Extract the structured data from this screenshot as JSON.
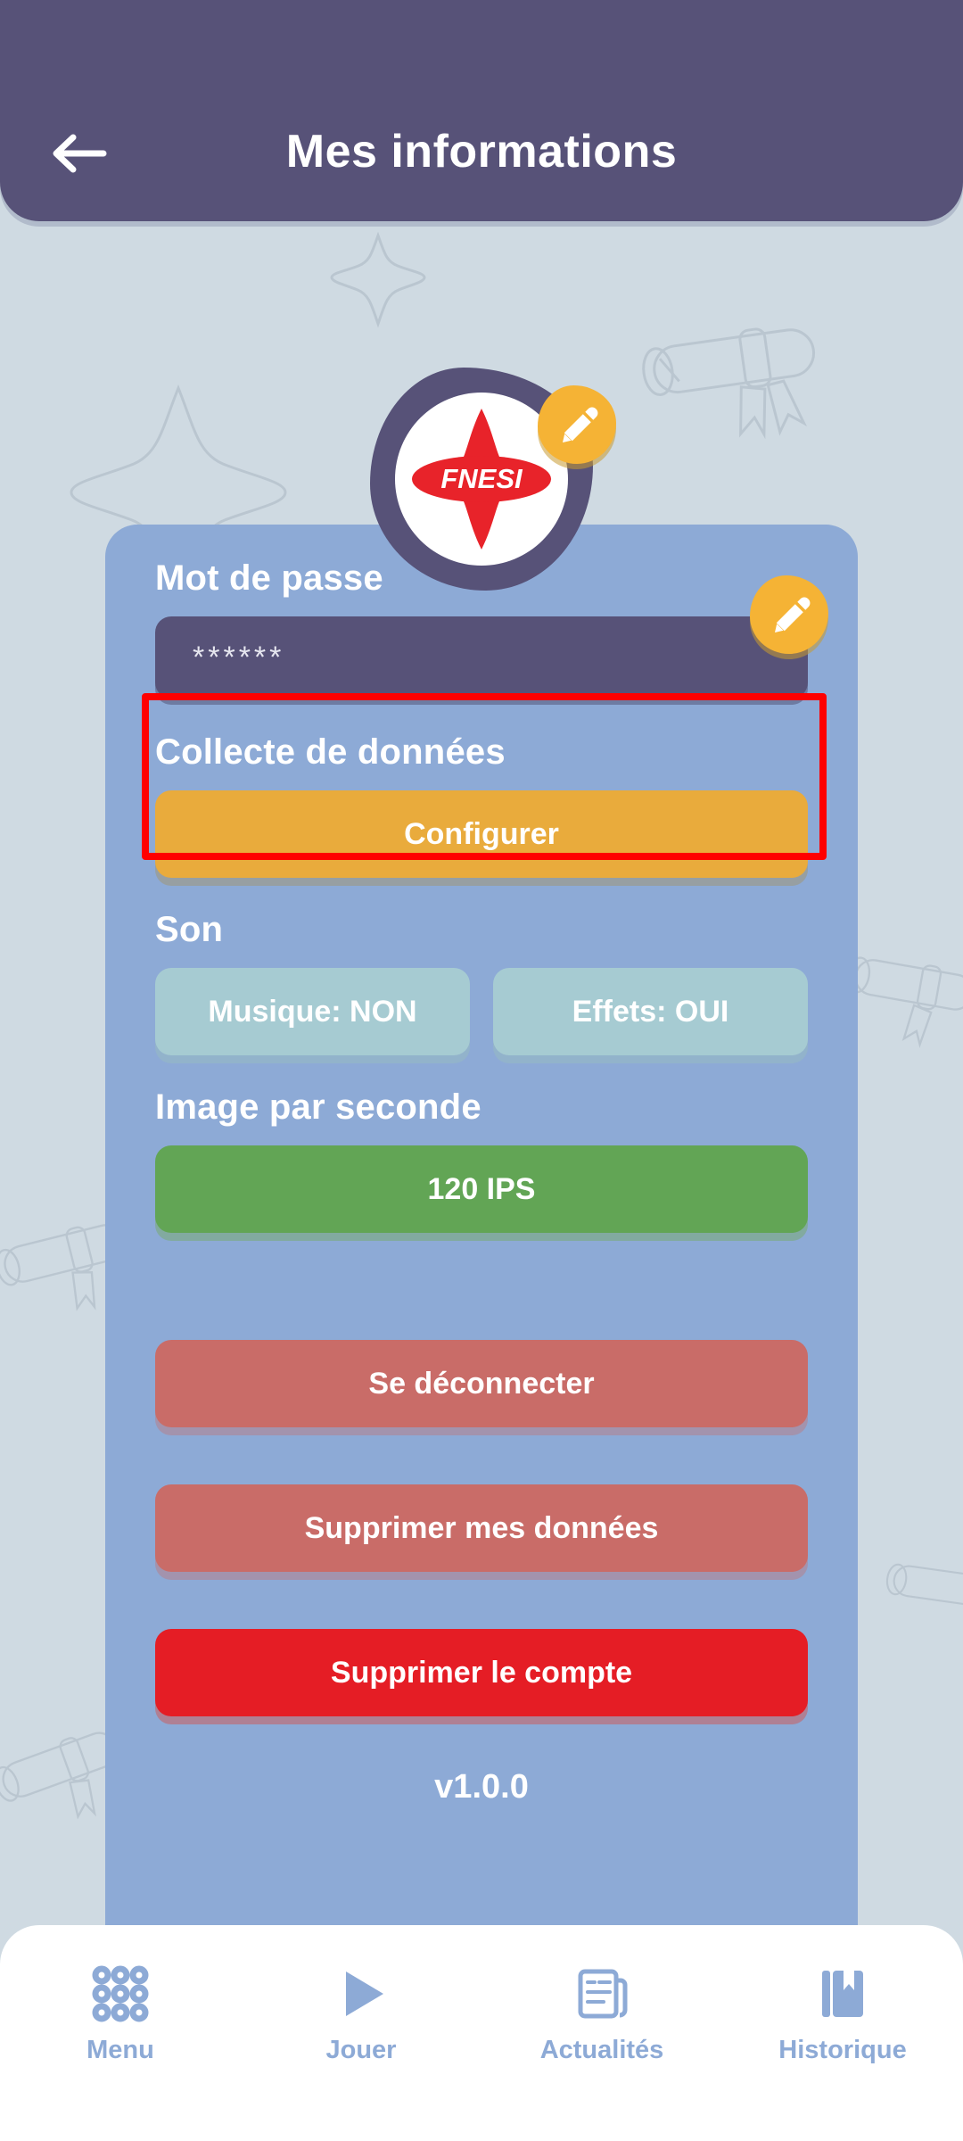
{
  "header": {
    "title": "Mes informations",
    "back_icon": "arrow-left-icon",
    "bg_color": "#575278"
  },
  "avatar": {
    "logo_text": "FNESI",
    "logo_color": "#e8232a",
    "blob_color": "#575278"
  },
  "edit_buttons": [
    {
      "icon": "pencil-icon",
      "name": "edit-avatar-button"
    },
    {
      "icon": "pencil-icon",
      "name": "edit-password-button"
    }
  ],
  "card": {
    "bg_color": "#8daad6",
    "password": {
      "label": "Mot de passe",
      "value": "******"
    },
    "data_collection": {
      "label": "Collecte de données",
      "button_label": "Configurer",
      "button_color": "#e9ab3c",
      "highlighted": true,
      "highlight_color": "#ff0000"
    },
    "sound": {
      "label": "Son",
      "options": [
        {
          "label": "Musique: NON"
        },
        {
          "label": "Effets: OUI"
        }
      ],
      "button_color": "#a6cbd2"
    },
    "fps": {
      "label": "Image par seconde",
      "button_label": "120 IPS",
      "button_color": "#62a555"
    },
    "actions": [
      {
        "label": "Se déconnecter",
        "color": "#c96c68",
        "name": "logout-button"
      },
      {
        "label": "Supprimer mes données",
        "color": "#c96c68",
        "name": "delete-data-button"
      },
      {
        "label": "Supprimer le compte",
        "color": "#e51d25",
        "name": "delete-account-button"
      }
    ],
    "version": "v1.0.0"
  },
  "bottom_nav": {
    "items": [
      {
        "label": "Menu",
        "icon": "grid-dots-icon"
      },
      {
        "label": "Jouer",
        "icon": "play-triangle-icon"
      },
      {
        "label": "Actualités",
        "icon": "news-document-icon"
      },
      {
        "label": "Historique",
        "icon": "book-bookmark-icon"
      }
    ],
    "color": "#8daad6"
  },
  "background": {
    "color": "#cfdae2",
    "decorations": [
      "star-outline",
      "scroll-diploma-outline"
    ]
  }
}
